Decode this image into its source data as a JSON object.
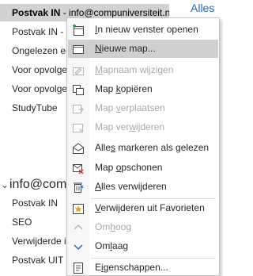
{
  "folder_pane": {
    "selected_item": {
      "name": "Postvak IN",
      "suffix": " - info@compuniversiteit.nl"
    },
    "items": [
      {
        "label": "Postvak IN - f"
      },
      {
        "label": "Ongelezen e-"
      },
      {
        "label": "Voor opvolge"
      },
      {
        "label": "Voor opvolge"
      },
      {
        "label": "StudyTube"
      }
    ],
    "account": {
      "chevron": "⌄",
      "label": "info@com"
    },
    "account_items": [
      {
        "label": "Postvak IN"
      },
      {
        "label": "SEO"
      },
      {
        "label": "Verwijderde it"
      },
      {
        "label": "Postvak UIT"
      }
    ]
  },
  "header": {
    "filter_tab": "Alles"
  },
  "context_menu": {
    "items": [
      {
        "pre": "",
        "key": "I",
        "post": "n nieuw venster openen",
        "icon": "new-window-icon",
        "disabled": false
      },
      {
        "pre": "",
        "key": "N",
        "post": "ieuwe map...",
        "icon": "new-folder-icon",
        "disabled": false,
        "highlight": true
      },
      {
        "pre": "",
        "key": "M",
        "post": "apnaam wijzigen",
        "icon": "rename-folder-icon",
        "disabled": true
      },
      {
        "pre": "Map ",
        "key": "k",
        "post": "opiëren",
        "icon": "copy-folder-icon",
        "disabled": false
      },
      {
        "pre": "Map ",
        "key": "v",
        "post": "erplaatsen",
        "icon": "move-folder-icon",
        "disabled": true
      },
      {
        "pre": "Map ver",
        "key": "w",
        "post": "ijderen",
        "icon": "delete-folder-icon",
        "disabled": true
      },
      {
        "pre": "Alle",
        "key": "s",
        "post": " markeren als gelezen",
        "icon": "mark-read-icon",
        "disabled": false
      },
      {
        "pre": "Map ",
        "key": "o",
        "post": "pschonen",
        "icon": "clean-up-icon",
        "disabled": false
      },
      {
        "pre": "",
        "key": "A",
        "post": "lles verwijderen",
        "icon": "delete-all-icon",
        "disabled": false
      },
      {
        "pre": "",
        "key": "V",
        "post": "erwijderen uit Favorieten",
        "icon": "favorites-remove-icon",
        "disabled": false
      },
      {
        "pre": "Om",
        "key": "h",
        "post": "oog",
        "icon": "move-up-icon",
        "disabled": true
      },
      {
        "pre": "Om",
        "key": "l",
        "post": "aag",
        "icon": "move-down-icon",
        "disabled": false
      },
      {
        "pre": "E",
        "key": "i",
        "post": "genschappen...",
        "icon": "properties-icon",
        "disabled": false
      }
    ]
  },
  "colors": {
    "accent": "#1e6bc4",
    "selected_bg": "#d2d2d2",
    "menu_highlight": "#cfcfcf",
    "favorite_star": "#e8a317",
    "delete_red": "#d13438"
  }
}
